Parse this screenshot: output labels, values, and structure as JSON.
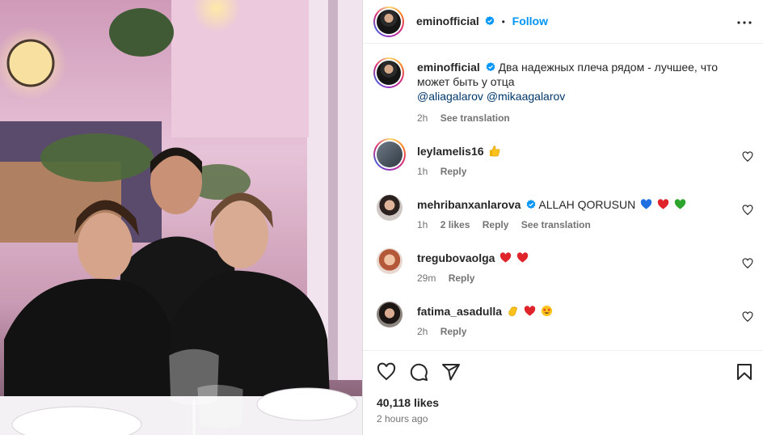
{
  "post": {
    "author": "eminofficial",
    "follow_label": "Follow",
    "caption_text": "Два надежных плеча рядом - лучшее, что может быть у отца",
    "caption_mentions": [
      "@aliagalarov",
      "@mikaagalarov"
    ],
    "caption_time": "2h",
    "caption_translation": "See translation",
    "likes": "40,118 likes",
    "posted_ago": "2 hours ago"
  },
  "comments": [
    {
      "user": "leylamelis16",
      "text": "",
      "emojis": [
        "thumbs-up"
      ],
      "time": "1h",
      "likes": "",
      "reply": "Reply",
      "translation": "",
      "verified": false
    },
    {
      "user": "mehribanxanlarova",
      "text": "ALLAH QORUSUN",
      "emojis": [
        "blue-heart",
        "red-heart",
        "green-heart"
      ],
      "time": "1h",
      "likes": "2 likes",
      "reply": "Reply",
      "translation": "See translation",
      "verified": true
    },
    {
      "user": "tregubovaolga",
      "text": "",
      "emojis": [
        "red-heart",
        "red-heart"
      ],
      "time": "29m",
      "likes": "",
      "reply": "Reply",
      "translation": "",
      "verified": false
    },
    {
      "user": "fatima_asadulla",
      "text": "",
      "emojis": [
        "clapping-hands",
        "red-heart",
        "star-struck"
      ],
      "time": "2h",
      "likes": "",
      "reply": "Reply",
      "translation": "",
      "verified": false
    }
  ],
  "icons": {
    "more": "more-horizontal-icon",
    "like": "heart-icon",
    "comment": "comment-icon",
    "share": "share-icon",
    "save": "bookmark-icon",
    "verified": "verified-badge-icon"
  },
  "colors": {
    "accent": "#0095f6",
    "mention": "#00376b",
    "verified": "#0095f6",
    "muted": "#737373"
  }
}
